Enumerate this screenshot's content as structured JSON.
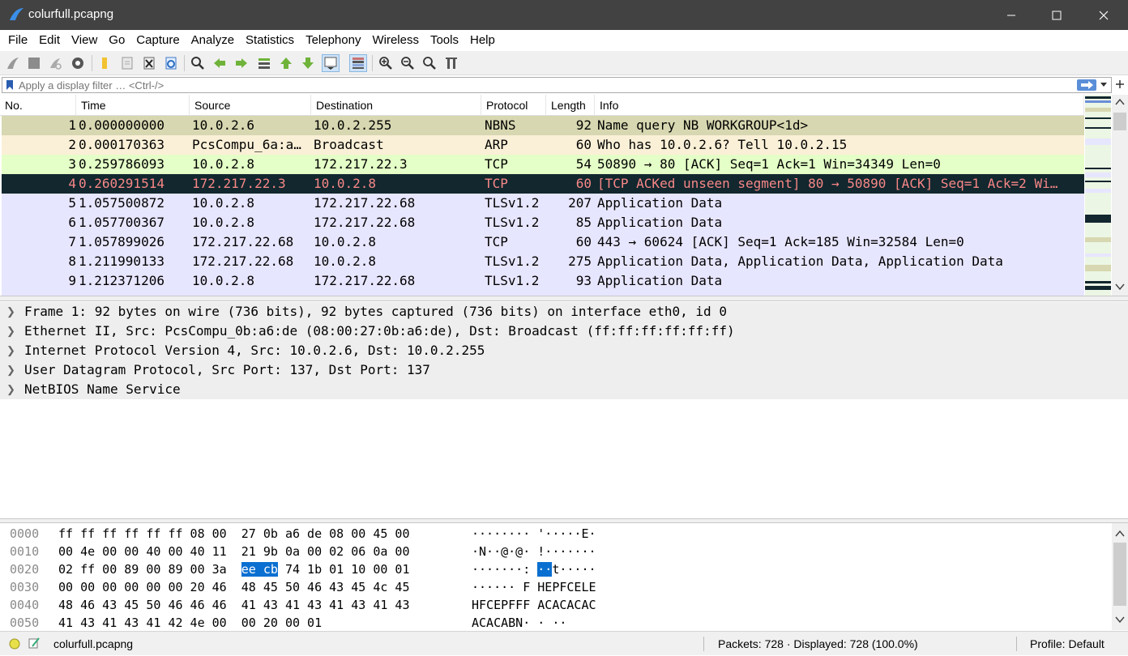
{
  "window": {
    "title": "colurfull.pcapng"
  },
  "menu": [
    "File",
    "Edit",
    "View",
    "Go",
    "Capture",
    "Analyze",
    "Statistics",
    "Telephony",
    "Wireless",
    "Tools",
    "Help"
  ],
  "filter": {
    "placeholder": "Apply a display filter … <Ctrl-/>"
  },
  "columns": [
    "No.",
    "Time",
    "Source",
    "Destination",
    "Protocol",
    "Length",
    "Info"
  ],
  "packets": [
    {
      "no": "1",
      "time": "0.000000000",
      "src": "10.0.2.6",
      "dst": "10.0.2.255",
      "proto": "NBNS",
      "len": "92",
      "info": "Name query NB WORKGROUP<1d>",
      "bg": "#d7d7b1",
      "fg": "#000000"
    },
    {
      "no": "2",
      "time": "0.000170363",
      "src": "PcsCompu_6a:a…",
      "dst": "Broadcast",
      "proto": "ARP",
      "len": "60",
      "info": "Who has 10.0.2.6? Tell 10.0.2.15",
      "bg": "#faf0d7",
      "fg": "#000000"
    },
    {
      "no": "3",
      "time": "0.259786093",
      "src": "10.0.2.8",
      "dst": "172.217.22.3",
      "proto": "TCP",
      "len": "54",
      "info": "50890 → 80 [ACK] Seq=1 Ack=1 Win=34349 Len=0",
      "bg": "#e4ffc7",
      "fg": "#000000"
    },
    {
      "no": "4",
      "time": "0.260291514",
      "src": "172.217.22.3",
      "dst": "10.0.2.8",
      "proto": "TCP",
      "len": "60",
      "info": "[TCP ACKed unseen segment] 80 → 50890 [ACK] Seq=1 Ack=2 Wi…",
      "bg": "#12272e",
      "fg": "#f78787"
    },
    {
      "no": "5",
      "time": "1.057500872",
      "src": "10.0.2.8",
      "dst": "172.217.22.68",
      "proto": "TLSv1.2",
      "len": "207",
      "info": "Application Data",
      "bg": "#e7e6ff",
      "fg": "#000000"
    },
    {
      "no": "6",
      "time": "1.057700367",
      "src": "10.0.2.8",
      "dst": "172.217.22.68",
      "proto": "TLSv1.2",
      "len": "85",
      "info": "Application Data",
      "bg": "#e7e6ff",
      "fg": "#000000"
    },
    {
      "no": "7",
      "time": "1.057899026",
      "src": "172.217.22.68",
      "dst": "10.0.2.8",
      "proto": "TCP",
      "len": "60",
      "info": "443 → 60624 [ACK] Seq=1 Ack=185 Win=32584 Len=0",
      "bg": "#e7e6ff",
      "fg": "#000000"
    },
    {
      "no": "8",
      "time": "1.211990133",
      "src": "172.217.22.68",
      "dst": "10.0.2.8",
      "proto": "TLSv1.2",
      "len": "275",
      "info": "Application Data, Application Data, Application Data",
      "bg": "#e7e6ff",
      "fg": "#000000"
    },
    {
      "no": "9",
      "time": "1.212371206",
      "src": "10.0.2.8",
      "dst": "172.217.22.68",
      "proto": "TLSv1.2",
      "len": "93",
      "info": "Application Data",
      "bg": "#e7e6ff",
      "fg": "#000000"
    }
  ],
  "details": [
    "Frame 1: 92 bytes on wire (736 bits), 92 bytes captured (736 bits) on interface eth0, id 0",
    "Ethernet II, Src: PcsCompu_0b:a6:de (08:00:27:0b:a6:de), Dst: Broadcast (ff:ff:ff:ff:ff:ff)",
    "Internet Protocol Version 4, Src: 10.0.2.6, Dst: 10.0.2.255",
    "User Datagram Protocol, Src Port: 137, Dst Port: 137",
    "NetBIOS Name Service"
  ],
  "bytes": [
    {
      "off": "0000",
      "hexA": "ff ff ff ff ff ff 08 00  27 0b a6 de 08 00 45 00",
      "hexHl": "",
      "hexB": "",
      "ascA": "········ '·····E·",
      "ascHl": "",
      "ascB": ""
    },
    {
      "off": "0010",
      "hexA": "00 4e 00 00 40 00 40 11  21 9b 0a 00 02 06 0a 00",
      "hexHl": "",
      "hexB": "",
      "ascA": "·N··@·@· !·······",
      "ascHl": "",
      "ascB": ""
    },
    {
      "off": "0020",
      "hexA": "02 ff 00 89 00 89 00 3a  ",
      "hexHl": "ee cb",
      "hexB": " 74 1b 01 10 00 01",
      "ascA": "·······: ",
      "ascHl": "··",
      "ascB": "t·····"
    },
    {
      "off": "0030",
      "hexA": "00 00 00 00 00 00 20 46  48 45 50 46 43 45 4c 45",
      "hexHl": "",
      "hexB": "",
      "ascA": "······ F HEPFCELE",
      "ascHl": "",
      "ascB": ""
    },
    {
      "off": "0040",
      "hexA": "48 46 43 45 50 46 46 46  41 43 41 43 41 43 41 43",
      "hexHl": "",
      "hexB": "",
      "ascA": "HFCEPFFF ACACACAC",
      "ascHl": "",
      "ascB": ""
    },
    {
      "off": "0050",
      "hexA": "41 43 41 43 41 42 4e 00  00 20 00 01",
      "hexHl": "",
      "hexB": "",
      "ascA": "ACACABN· · ··",
      "ascHl": "",
      "ascB": ""
    }
  ],
  "status": {
    "file": "colurfull.pcapng",
    "packets": "Packets: 728 · Displayed: 728 (100.0%)",
    "profile": "Profile: Default"
  },
  "icons": [
    "shark-fin-icon",
    "stop-icon",
    "restart-icon",
    "options-gear-icon",
    "open-folder-icon",
    "save-file-icon",
    "close-file-icon",
    "reload-icon",
    "find-icon",
    "back-arrow-icon",
    "forward-arrow-icon",
    "go-to-packet-icon",
    "first-packet-icon",
    "last-packet-icon",
    "autoscroll-icon",
    "colorize-icon",
    "zoom-in-icon",
    "zoom-out-icon",
    "normal-size-icon",
    "resize-columns-icon"
  ],
  "colors": {
    "titlebar": "#424242",
    "selection": "#0a6fd0"
  }
}
